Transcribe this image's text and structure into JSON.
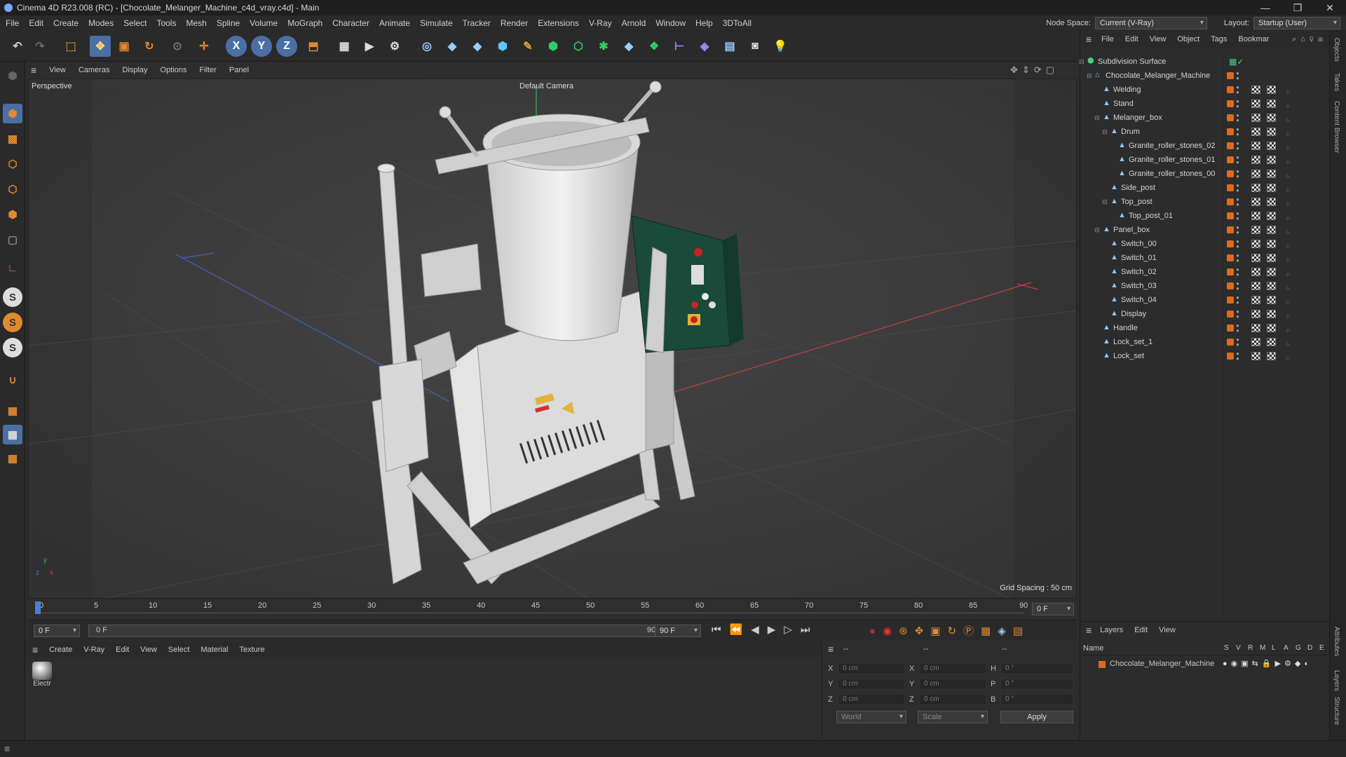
{
  "window": {
    "title": "Cinema 4D R23.008 (RC) - [Chocolate_Melanger_Machine_c4d_vray.c4d] - Main"
  },
  "menu": [
    "File",
    "Edit",
    "Create",
    "Modes",
    "Select",
    "Tools",
    "Mesh",
    "Spline",
    "Volume",
    "MoGraph",
    "Character",
    "Animate",
    "Simulate",
    "Tracker",
    "Render",
    "Extensions",
    "V-Ray",
    "Arnold",
    "Window",
    "Help",
    "3DToAll"
  ],
  "nodespace": {
    "label": "Node Space:",
    "value": "Current (V-Ray)"
  },
  "layout": {
    "label": "Layout:",
    "value": "Startup (User)"
  },
  "viewport": {
    "menu": [
      "View",
      "Cameras",
      "Display",
      "Options",
      "Filter",
      "Panel"
    ],
    "label": "Perspective",
    "camera": "Default Camera",
    "grid_spacing": "Grid Spacing : 50 cm"
  },
  "timeline": {
    "ticks": [
      "0",
      "5",
      "10",
      "15",
      "20",
      "25",
      "30",
      "35",
      "40",
      "45",
      "50",
      "55",
      "60",
      "65",
      "70",
      "75",
      "80",
      "85",
      "90"
    ],
    "current_frame": "0 F",
    "start": "0 F",
    "range_start": "0 F",
    "range_end": "90 F",
    "end": "90 F"
  },
  "material": {
    "menu": [
      "Create",
      "V-Ray",
      "Edit",
      "View",
      "Select",
      "Material",
      "Texture"
    ],
    "item": "Electr"
  },
  "coords": {
    "header": [
      "--",
      "--",
      "--"
    ],
    "rows": [
      {
        "a": "X",
        "av": "0 cm",
        "b": "X",
        "bv": "0 cm",
        "c": "H",
        "cv": "0 °"
      },
      {
        "a": "Y",
        "av": "0 cm",
        "b": "Y",
        "bv": "0 cm",
        "c": "P",
        "cv": "0 °"
      },
      {
        "a": "Z",
        "av": "0 cm",
        "b": "Z",
        "bv": "0 cm",
        "c": "B",
        "cv": "0 °"
      }
    ],
    "space": "World",
    "mode": "Scale",
    "apply": "Apply"
  },
  "objects": {
    "menu": [
      "File",
      "Edit",
      "View",
      "Object",
      "Tags",
      "Bookmar"
    ],
    "items": [
      {
        "name": "Subdivision Surface",
        "depth": 0
      },
      {
        "name": "Chocolate_Melanger_Machine",
        "depth": 1
      },
      {
        "name": "Welding",
        "depth": 2
      },
      {
        "name": "Stand",
        "depth": 2
      },
      {
        "name": "Melanger_box",
        "depth": 2
      },
      {
        "name": "Drum",
        "depth": 3
      },
      {
        "name": "Granite_roller_stones_02",
        "depth": 4
      },
      {
        "name": "Granite_roller_stones_01",
        "depth": 4
      },
      {
        "name": "Granite_roller_stones_00",
        "depth": 4
      },
      {
        "name": "Side_post",
        "depth": 3
      },
      {
        "name": "Top_post",
        "depth": 3
      },
      {
        "name": "Top_post_01",
        "depth": 4
      },
      {
        "name": "Panel_box",
        "depth": 2
      },
      {
        "name": "Switch_00",
        "depth": 3
      },
      {
        "name": "Switch_01",
        "depth": 3
      },
      {
        "name": "Switch_02",
        "depth": 3
      },
      {
        "name": "Switch_03",
        "depth": 3
      },
      {
        "name": "Switch_04",
        "depth": 3
      },
      {
        "name": "Display",
        "depth": 3
      },
      {
        "name": "Handle",
        "depth": 2
      },
      {
        "name": "Lock_set_1",
        "depth": 2
      },
      {
        "name": "Lock_set",
        "depth": 2
      }
    ]
  },
  "layers": {
    "menu": [
      "Layers",
      "Edit",
      "View"
    ],
    "header": {
      "name": "Name",
      "cols": [
        "S",
        "V",
        "R",
        "M",
        "L",
        "A",
        "G",
        "D",
        "E"
      ]
    },
    "items": [
      "Chocolate_Melanger_Machine"
    ]
  },
  "right_tabs": [
    "Objects",
    "Takes",
    "Content Browser",
    "Attributes",
    "Layers",
    "Structure"
  ],
  "colors": {
    "accent": "#e06a1f",
    "selection": "#4a7fd4",
    "panel": "#2c2c2c"
  }
}
